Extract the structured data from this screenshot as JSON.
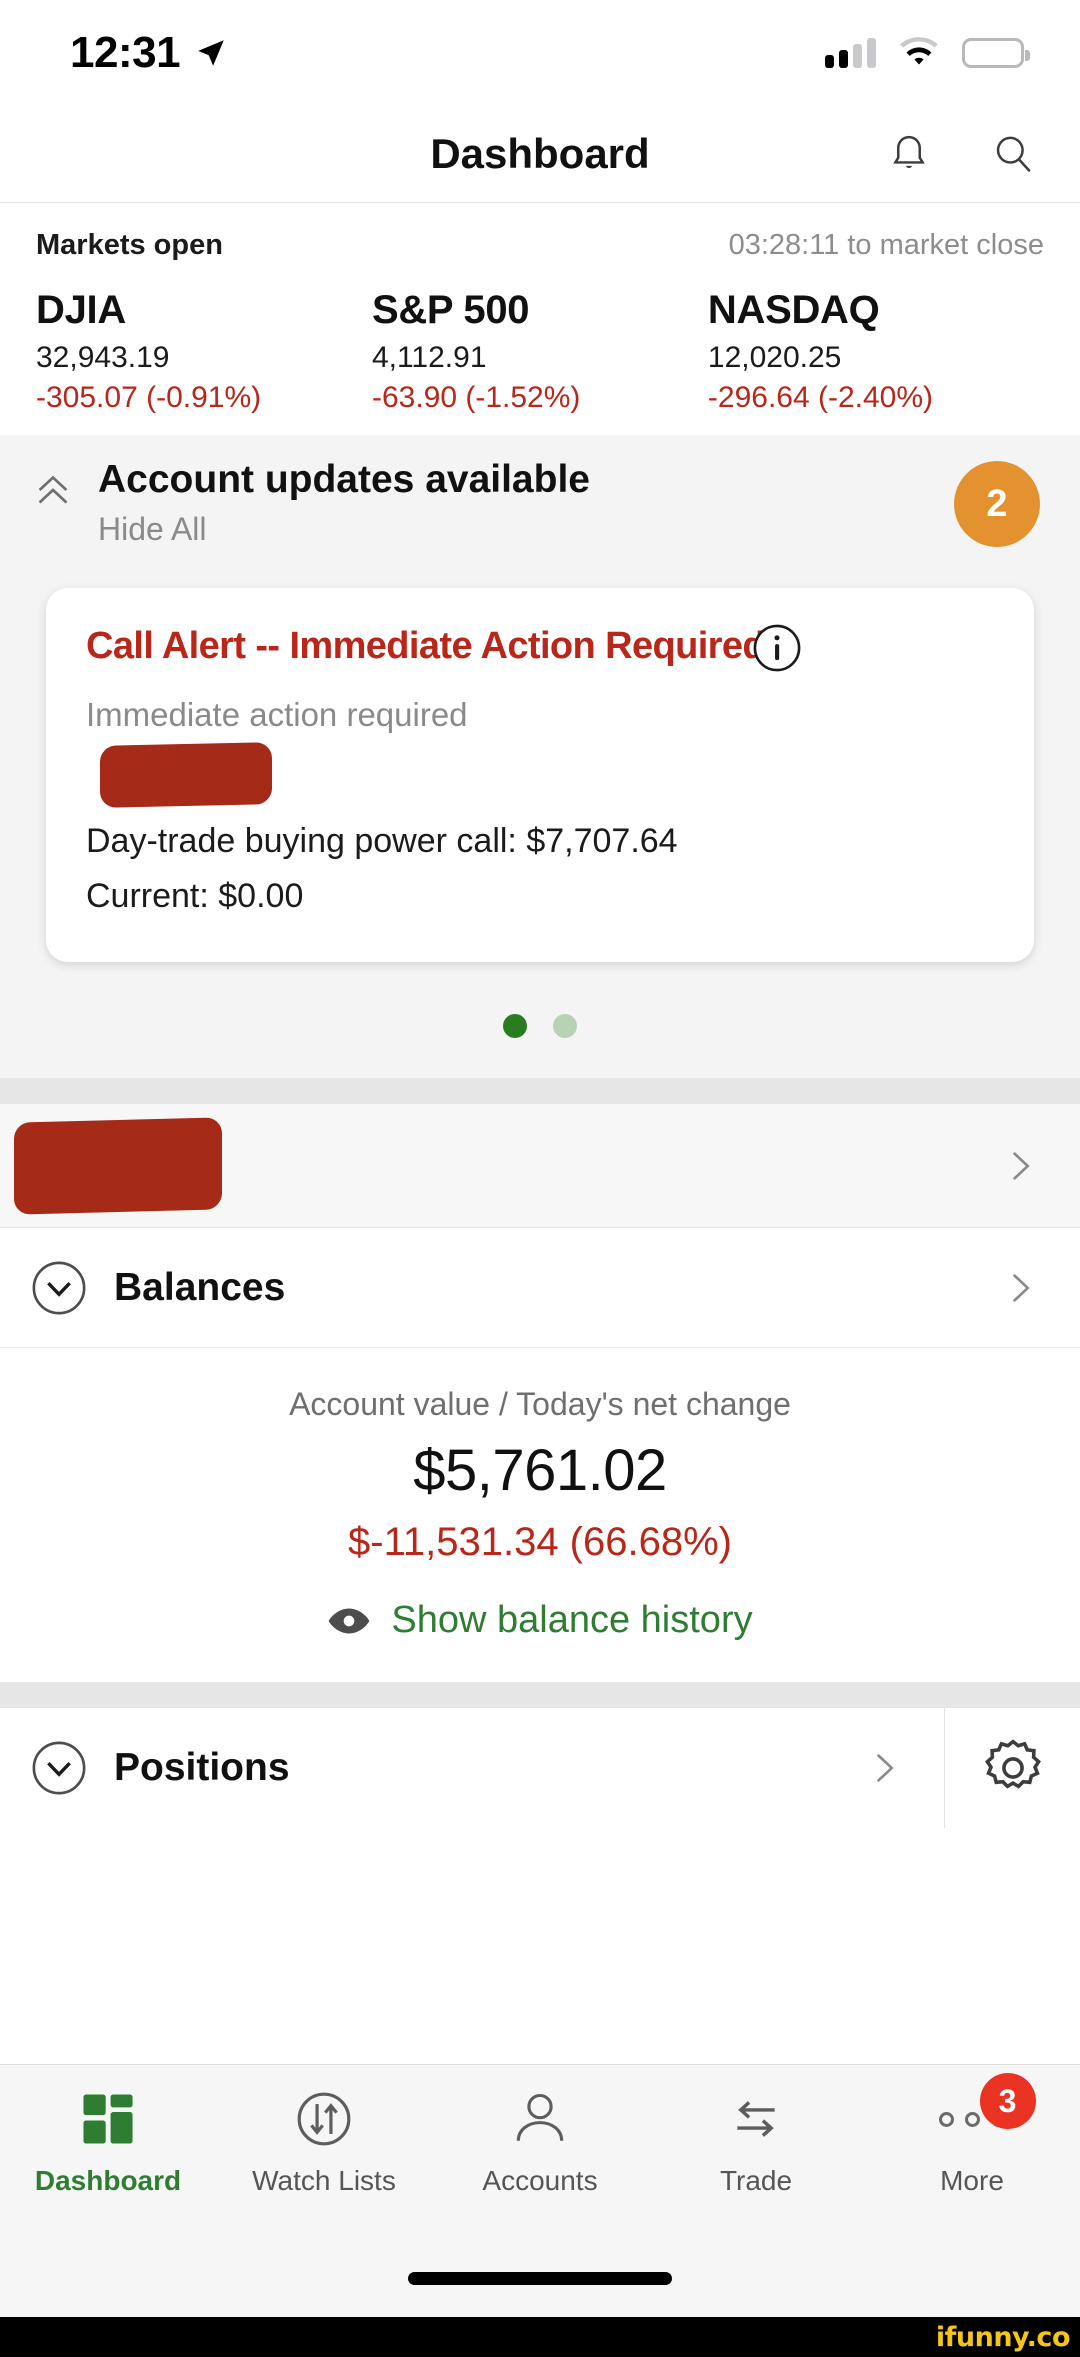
{
  "status_bar": {
    "time": "12:31",
    "location_icon": "location-arrow-icon",
    "signal_icon": "cellular-signal-icon",
    "wifi_icon": "wifi-icon",
    "battery_icon": "battery-icon"
  },
  "header": {
    "title": "Dashboard",
    "notifications_icon": "bell-icon",
    "search_icon": "search-icon"
  },
  "market": {
    "status": "Markets open",
    "countdown": "03:28:11 to market close",
    "indices": [
      {
        "name": "DJIA",
        "value": "32,943.19",
        "change": "-305.07 (-0.91%)"
      },
      {
        "name": "S&P 500",
        "value": "4,112.91",
        "change": "-63.90 (-1.52%)"
      },
      {
        "name": "NASDAQ",
        "value": "12,020.25",
        "change": "-296.64 (-2.40%)"
      }
    ],
    "negative_color": "#b9261a"
  },
  "updates": {
    "title": "Account updates available",
    "hide_all": "Hide All",
    "count": "2",
    "badge_color": "#e3922f",
    "collapse_icon": "chevron-double-up-icon"
  },
  "alert_card": {
    "title": "Call Alert -- Immediate Action Required",
    "info_icon": "info-circle-icon",
    "subtitle": "Immediate action required",
    "redacted_note": "",
    "line1": "Day-trade buying power call: $7,707.64",
    "line2": "Current: $0.00",
    "title_color": "#b9261a"
  },
  "carousel": {
    "dots": 2,
    "active_index": 0,
    "active_color": "#2a7d1f",
    "inactive_color": "#b7d3b4"
  },
  "account_row": {
    "name_redacted": "",
    "chevron_icon": "chevron-right-icon"
  },
  "balances": {
    "label": "Balances",
    "collapse_icon": "circle-chevron-down-icon",
    "chevron_icon": "chevron-right-icon",
    "caption": "Account value / Today's net change",
    "value": "$5,761.02",
    "change": "$-11,531.34 (66.68%)",
    "change_color": "#b9261a",
    "history_link": "Show balance history",
    "history_icon": "eye-icon",
    "history_color": "#2f7d32"
  },
  "positions": {
    "label": "Positions",
    "collapse_icon": "circle-chevron-down-icon",
    "chevron_icon": "chevron-right-icon",
    "settings_icon": "gear-icon"
  },
  "tabbar": {
    "items": [
      {
        "label": "Dashboard",
        "icon": "grid-icon",
        "active": true
      },
      {
        "label": "Watch Lists",
        "icon": "circle-arrows-icon",
        "active": false
      },
      {
        "label": "Accounts",
        "icon": "person-icon",
        "active": false
      },
      {
        "label": "Trade",
        "icon": "transfer-arrows-icon",
        "active": false
      },
      {
        "label": "More",
        "icon": "ellipsis-icon",
        "active": false,
        "badge": "3"
      }
    ],
    "active_color": "#2f7d32",
    "badge_color": "#ea3323"
  },
  "watermark": {
    "text": "ifunny.co"
  }
}
